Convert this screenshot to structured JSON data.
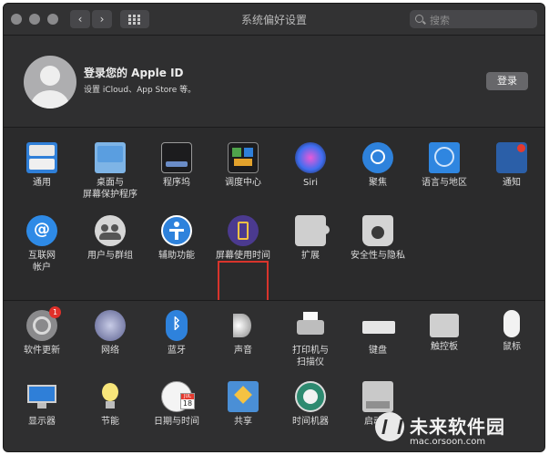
{
  "window": {
    "title": "系统偏好设置",
    "back_glyph": "‹",
    "forward_glyph": "›"
  },
  "search": {
    "placeholder": "搜索"
  },
  "account": {
    "title": "登录您的 Apple ID",
    "subtitle": "设置 iCloud、App Store 等。",
    "login_label": "登录"
  },
  "row1": [
    {
      "label": "通用",
      "icon": "general-icon"
    },
    {
      "label": "桌面与\n屏幕保护程序",
      "icon": "desktop-icon"
    },
    {
      "label": "程序坞",
      "icon": "dock-icon"
    },
    {
      "label": "调度中心",
      "icon": "mission-control-icon"
    },
    {
      "label": "Siri",
      "icon": "siri-icon"
    },
    {
      "label": "聚焦",
      "icon": "spotlight-icon"
    },
    {
      "label": "语言与地区",
      "icon": "language-icon"
    },
    {
      "label": "通知",
      "icon": "notifications-icon"
    }
  ],
  "row2": [
    {
      "label": "互联网\n帐户",
      "icon": "internet-accounts-icon"
    },
    {
      "label": "用户与群组",
      "icon": "users-icon"
    },
    {
      "label": "辅助功能",
      "icon": "accessibility-icon"
    },
    {
      "label": "屏幕使用时间",
      "icon": "screen-time-icon"
    },
    {
      "label": "扩展",
      "icon": "extensions-icon"
    },
    {
      "label": "安全性与隐私",
      "icon": "security-icon"
    }
  ],
  "row3": [
    {
      "label": "软件更新",
      "icon": "software-update-icon",
      "badge": "1"
    },
    {
      "label": "网络",
      "icon": "network-icon"
    },
    {
      "label": "蓝牙",
      "icon": "bluetooth-icon"
    },
    {
      "label": "声音",
      "icon": "sound-icon"
    },
    {
      "label": "打印机与\n扫描仪",
      "icon": "printer-icon"
    },
    {
      "label": "键盘",
      "icon": "keyboard-icon"
    },
    {
      "label": "触控板",
      "icon": "trackpad-icon"
    },
    {
      "label": "鼠标",
      "icon": "mouse-icon"
    }
  ],
  "row4": [
    {
      "label": "显示器",
      "icon": "display-icon"
    },
    {
      "label": "节能",
      "icon": "energy-icon"
    },
    {
      "label": "日期与时间",
      "icon": "date-time-icon",
      "cal_month": "JUL",
      "cal_day": "18"
    },
    {
      "label": "共享",
      "icon": "sharing-icon"
    },
    {
      "label": "时间机器",
      "icon": "time-machine-icon"
    },
    {
      "label": "启动磁",
      "icon": "startup-disk-icon"
    }
  ],
  "watermark": {
    "brand": "未来软件园",
    "site": "mac.orsoon.com"
  }
}
